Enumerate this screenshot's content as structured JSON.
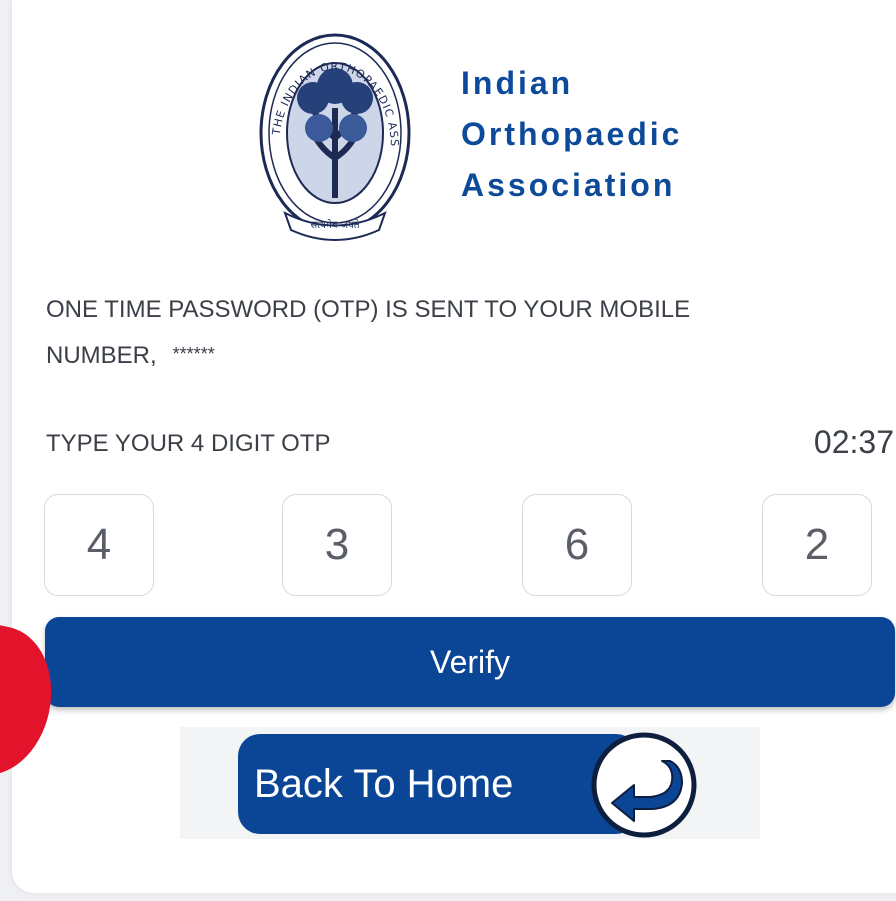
{
  "org": {
    "line1": "Indian",
    "line2": "Orthopaedic",
    "line3": "Association",
    "seal_text": "THE INDIAN ORTHOPAEDIC ASSOCIATION",
    "seal_motto": "सत्यमेव जयते"
  },
  "otp": {
    "message_line1": "ONE TIME PASSWORD (OTP) IS SENT TO YOUR MOBILE",
    "message_line2": "NUMBER,",
    "masked_number": "******",
    "label": "TYPE YOUR 4 DIGIT OTP",
    "timer": "02:37",
    "digits": [
      "4",
      "3",
      "6",
      "2"
    ]
  },
  "actions": {
    "verify_label": "Verify",
    "back_label": "Back To Home"
  },
  "colors": {
    "brand_blue": "#0b4696",
    "accent_red": "#e3132c"
  }
}
